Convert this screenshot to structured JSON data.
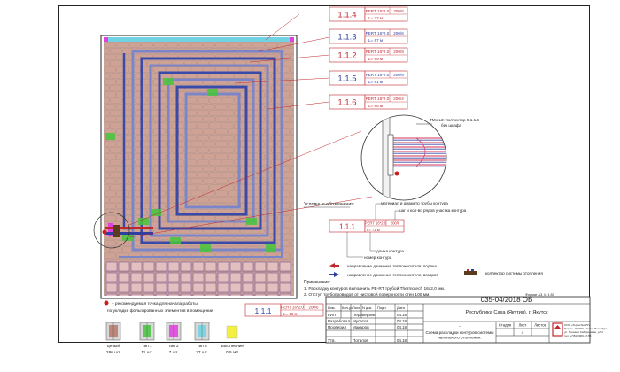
{
  "loops": [
    {
      "id": "1.1.4",
      "pipe": "PERT 16*2.0",
      "spacing": "200/6",
      "length": "L= 72 м",
      "color": "#c0282d"
    },
    {
      "id": "1.1.3",
      "pipe": "PERT 16*2.0",
      "spacing": "200/6",
      "length": "L= 67 м",
      "color": "#2f3f9f"
    },
    {
      "id": "1.1.2",
      "pipe": "PERT 16*2.0",
      "spacing": "200/9",
      "length": "L= 69 м",
      "color": "#c0282d"
    },
    {
      "id": "1.1.5",
      "pipe": "PERT 16*2.0",
      "spacing": "200/9",
      "length": "L= 61 м",
      "color": "#2f3f9f"
    },
    {
      "id": "1.1.6",
      "pipe": "PERT 16*2.0",
      "spacing": "200/4",
      "length": "L= 65 м",
      "color": "#c0282d"
    }
  ],
  "detail": {
    "manifold_label": "TMx-L3+Коллектор К.1.1.6",
    "manifold_sub": "без шкафа"
  },
  "legend": {
    "title": "Условные обозначения:",
    "sample": {
      "id": "1.1.1",
      "pipe": "PERT 16*2.0",
      "spacing": "200/6",
      "length": "L= 71 м"
    },
    "note_material": "материал и диаметр трубы контура",
    "note_step": "шаг и кол-во рядов участка контура",
    "note_length": "длина контура",
    "note_number": "номер контура",
    "supply_dir": "направление движения теплоносителя, подача",
    "return_dir": "направление движения теплоносителя, возврат",
    "manifold": "коллектор системы отопления"
  },
  "notes": {
    "title": "Примечания:",
    "line1": "1. Раскладку контуров выполнить PE-RT трубой Thermotech 16х2,0 мм.",
    "line2": "2. Отступ трубопроводов от чистовой поверхности стен 100 мм."
  },
  "start_point": {
    "line1": "- рекомендуемая точка для начала работы",
    "line2": "по укладке фольгированных элементов в помещении"
  },
  "bottom_box": {
    "id": "1.1.1",
    "pipe": "PERT 16*2.0",
    "spacing": "200/6",
    "length": "L= 48 м"
  },
  "elements": [
    {
      "label": "целый",
      "count": "286 шт.",
      "color": "#b87a6a"
    },
    {
      "label": "тип 1",
      "count": "11 шт.",
      "color": "#46c63c"
    },
    {
      "label": "тип 2",
      "count": "7 шт.",
      "color": "#e040e0"
    },
    {
      "label": "тип 3",
      "count": "27 шт.",
      "color": "#6fd3e3"
    },
    {
      "label": "заполнение",
      "count": "0.5 м2",
      "color": "#f4f040"
    }
  ],
  "format": "Формат А3, М 1:50",
  "stamp": {
    "code": "035-04/2018 ОВ",
    "location": "Республика Саха (Якутия), г. Якутск",
    "col_izm": "Изм.",
    "col_kol": "Кол.уч",
    "col_list": "Лист",
    "col_ndok": "N док.",
    "col_podp": "Подп.",
    "col_data": "Дата",
    "rows": [
      {
        "role": "ГИП",
        "name": "Переверзев",
        "date": "04.18"
      },
      {
        "role": "Разработал",
        "name": "Мусатов",
        "date": "04.18"
      },
      {
        "role": "Проверил",
        "name": "Макаров",
        "date": "04.18"
      },
      {
        "role": "Утв.",
        "name": "Потапов",
        "date": "04.18"
      }
    ],
    "dash": "-",
    "stage_h": "Стадия",
    "sheet_h": "Лист",
    "sheets_h": "Листов",
    "sheet_no": "4",
    "drawing_title": "Схема раскладки контуров системы напольного отопления.",
    "company_line1": "ООО «ТермоТех-РУ»",
    "company_line2": "Россия, 197183, г.Санкт-Петербург,",
    "company_line3": "ул. Полевая Сабировская, д.54",
    "company_line4": "тел: +7(812)309-67-55",
    "brand_color": "#c0282d"
  }
}
